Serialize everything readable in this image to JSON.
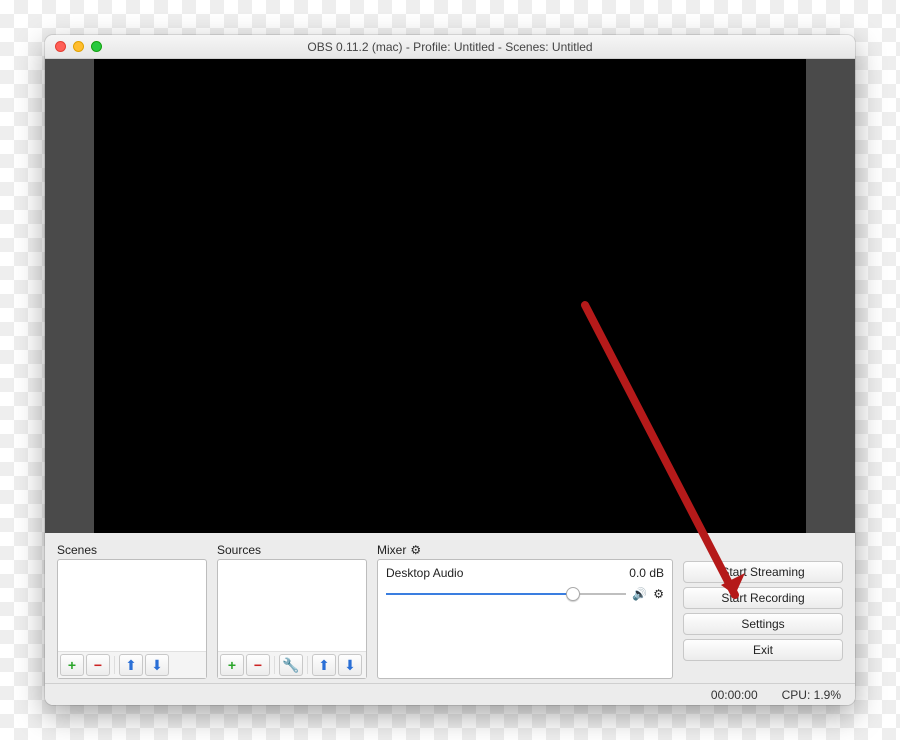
{
  "window": {
    "title": "OBS 0.11.2 (mac) - Profile: Untitled - Scenes: Untitled"
  },
  "panels": {
    "scenes_label": "Scenes",
    "sources_label": "Sources",
    "mixer_label": "Mixer"
  },
  "mixer": {
    "track_name": "Desktop Audio",
    "track_level": "0.0 dB"
  },
  "buttons": {
    "start_streaming": "Start Streaming",
    "start_recording": "Start Recording",
    "settings": "Settings",
    "exit": "Exit"
  },
  "status": {
    "time": "00:00:00",
    "cpu": "CPU: 1.9%"
  }
}
